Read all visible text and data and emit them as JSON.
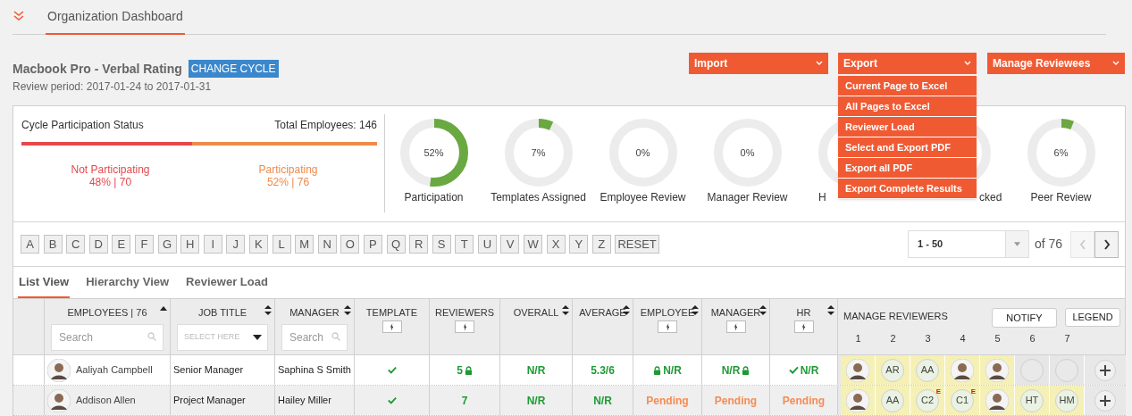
{
  "header": {
    "tab": "Organization Dashboard"
  },
  "cycle": {
    "title": "Macbook Pro - Verbal Rating",
    "change_button": "CHANGE CYCLE",
    "period": "Review period: 2017-01-24 to 2017-01-31"
  },
  "actions": [
    {
      "label": "Import"
    },
    {
      "label": "Export",
      "expanded": true,
      "menu": [
        "Current Page to Excel",
        "All Pages to Excel",
        "Reviewer Load",
        "Select and Export PDF",
        "Export all PDF",
        "Export Complete Results"
      ]
    },
    {
      "label": "Manage Reviewees"
    }
  ],
  "participation": {
    "title": "Cycle Participation Status",
    "total": "Total Employees: 146",
    "level": 0.48,
    "segments": [
      {
        "label": "Not Participating",
        "value": "48% | 70",
        "color": "#e8474c"
      },
      {
        "label": "Participating",
        "value": "52% | 76",
        "color": "#ef8a4b"
      }
    ]
  },
  "gauges": [
    {
      "kind": "full",
      "value": "52%",
      "level": 0.52,
      "label": "Participation"
    },
    {
      "kind": "full",
      "value": "7%",
      "level": 0.07,
      "label": "Templates Assigned"
    },
    {
      "kind": "full",
      "value": "0%",
      "level": 0,
      "label": "Employee Review"
    },
    {
      "kind": "full",
      "value": "0%",
      "level": 0,
      "label": "Manager Review"
    },
    {
      "kind": "head",
      "label": "H"
    },
    {
      "kind": "tail",
      "label": "cked"
    },
    {
      "kind": "full",
      "value": "6%",
      "level": 0.06,
      "label": "Peer Review"
    }
  ],
  "letters": [
    "A",
    "B",
    "C",
    "D",
    "E",
    "F",
    "G",
    "H",
    "I",
    "J",
    "K",
    "L",
    "M",
    "N",
    "O",
    "P",
    "Q",
    "R",
    "S",
    "T",
    "U",
    "V",
    "W",
    "X",
    "Y",
    "Z"
  ],
  "reset": "RESET",
  "pagination": {
    "range": "1 - 50",
    "of": "of 76",
    "prev_disabled": true
  },
  "views": [
    {
      "label": "List View",
      "selected": true
    },
    {
      "label": "Hierarchy View",
      "selected": false
    },
    {
      "label": "Reviewer Load",
      "selected": false
    }
  ],
  "table": {
    "columns": [
      {
        "label": "EMPLOYEES | 76",
        "sorted": true,
        "sortable": true,
        "kind": "search",
        "placeholder": "Search"
      },
      {
        "label": "JOB TITLE",
        "sorted": false,
        "sortable": true,
        "kind": "select",
        "placeholder": "SELECT HERE"
      },
      {
        "label": "MANAGER",
        "sorted": false,
        "sortable": true,
        "kind": "search",
        "placeholder": "Search"
      },
      {
        "label": "TEMPLATE",
        "sorted": false,
        "sortable": false,
        "kind": "bulk"
      },
      {
        "label": "REVIEWERS",
        "sorted": false,
        "sortable": false,
        "kind": "bulk"
      },
      {
        "label": "OVERALL",
        "sorted": false,
        "sortable": true,
        "kind": "plain"
      },
      {
        "label": "AVERAGE",
        "sorted": false,
        "sortable": true,
        "kind": "plain"
      },
      {
        "label": "EMPLOYEE",
        "sorted": false,
        "sortable": true,
        "kind": "bulk"
      },
      {
        "label": "MANAGER",
        "sorted": false,
        "sortable": true,
        "kind": "bulk"
      },
      {
        "label": "HR",
        "sorted": false,
        "sortable": true,
        "kind": "bulk"
      }
    ],
    "manage": {
      "title": "MANAGE REVIEWERS",
      "notify": "NOTIFY",
      "legend": "LEGEND",
      "slots": [
        "1",
        "2",
        "3",
        "4",
        "5",
        "6",
        "7"
      ]
    },
    "rows": [
      {
        "name": "Aaliyah Campbell",
        "job": "Senior Manager",
        "manager": "Saphina S Smith",
        "template_assigned": true,
        "scores": [
          {
            "text": "5",
            "color": "#1e9a35",
            "locked": true,
            "done": false
          },
          {
            "text": "N/R",
            "color": "#1e9a35",
            "locked": false,
            "done": false
          },
          {
            "text": "5.3/6",
            "color": "#1e9a35",
            "locked": false,
            "done": false
          },
          {
            "text": "N/R",
            "color": "#1e9a35",
            "locked": true,
            "done": false
          },
          {
            "text": "N/R",
            "color": "#1e9a35",
            "locked": true,
            "done": false
          },
          {
            "text": "N/R",
            "color": "#1e9a35",
            "locked": false,
            "done": true
          }
        ],
        "reviewers": [
          {
            "kind": "photo"
          },
          {
            "kind": "initials",
            "text": "AR"
          },
          {
            "kind": "initials",
            "text": "AA"
          },
          {
            "kind": "photo"
          },
          {
            "kind": "photo"
          },
          {
            "kind": "empty"
          },
          {
            "kind": "empty"
          }
        ]
      },
      {
        "name": "Addison Allen",
        "job": "Project Manager",
        "manager": "Hailey Miller",
        "template_assigned": true,
        "scores": [
          {
            "text": "7",
            "color": "#1e9a35",
            "locked": false,
            "done": false
          },
          {
            "text": "N/R",
            "color": "#1e9a35",
            "locked": false,
            "done": false
          },
          {
            "text": "N/R",
            "color": "#1e9a35",
            "locked": false,
            "done": false
          },
          {
            "text": "Pending",
            "color": "#f58c54",
            "locked": false,
            "done": false
          },
          {
            "text": "Pending",
            "color": "#f58c54",
            "locked": false,
            "done": false
          },
          {
            "text": "Pending",
            "color": "#f58c54",
            "locked": false,
            "done": false
          }
        ],
        "reviewers": [
          {
            "kind": "photo"
          },
          {
            "kind": "initials",
            "text": "AA"
          },
          {
            "kind": "initials",
            "text": "C2",
            "badge": "E"
          },
          {
            "kind": "initials",
            "text": "C1",
            "badge": "E"
          },
          {
            "kind": "photo"
          },
          {
            "kind": "initials",
            "text": "HT"
          },
          {
            "kind": "initials",
            "text": "HM"
          }
        ]
      }
    ]
  }
}
